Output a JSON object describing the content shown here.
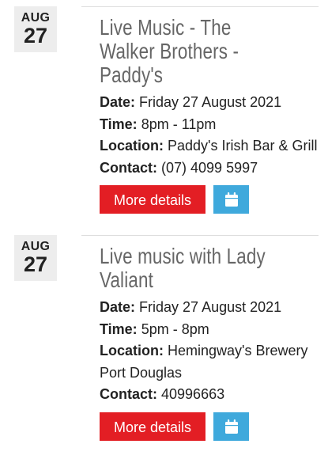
{
  "events": [
    {
      "month": "AUG",
      "day": "27",
      "title": "Live Music - The Walker Brothers - Paddy's",
      "date_label": "Date:",
      "date_value": "Friday 27 August 2021",
      "time_label": "Time:",
      "time_value": "8pm - 11pm",
      "location_label": "Location:",
      "location_value": "Paddy's Irish Bar & Grill",
      "contact_label": "Contact:",
      "contact_value": "(07) 4099 5997",
      "more_label": "More details",
      "calendar_icon": "calendar-icon"
    },
    {
      "month": "AUG",
      "day": "27",
      "title": "Live music with Lady Valiant",
      "date_label": "Date:",
      "date_value": "Friday 27 August 2021",
      "time_label": "Time:",
      "time_value": "5pm - 8pm",
      "location_label": "Location:",
      "location_value": "Hemingway's Brewery Port Douglas",
      "contact_label": "Contact:",
      "contact_value": "40996663",
      "more_label": "More details",
      "calendar_icon": "calendar-icon"
    }
  ],
  "colors": {
    "more_button": "#e31e24",
    "calendar_button": "#3fa9dc",
    "date_badge_bg": "#ededed",
    "title_text": "#666666"
  }
}
